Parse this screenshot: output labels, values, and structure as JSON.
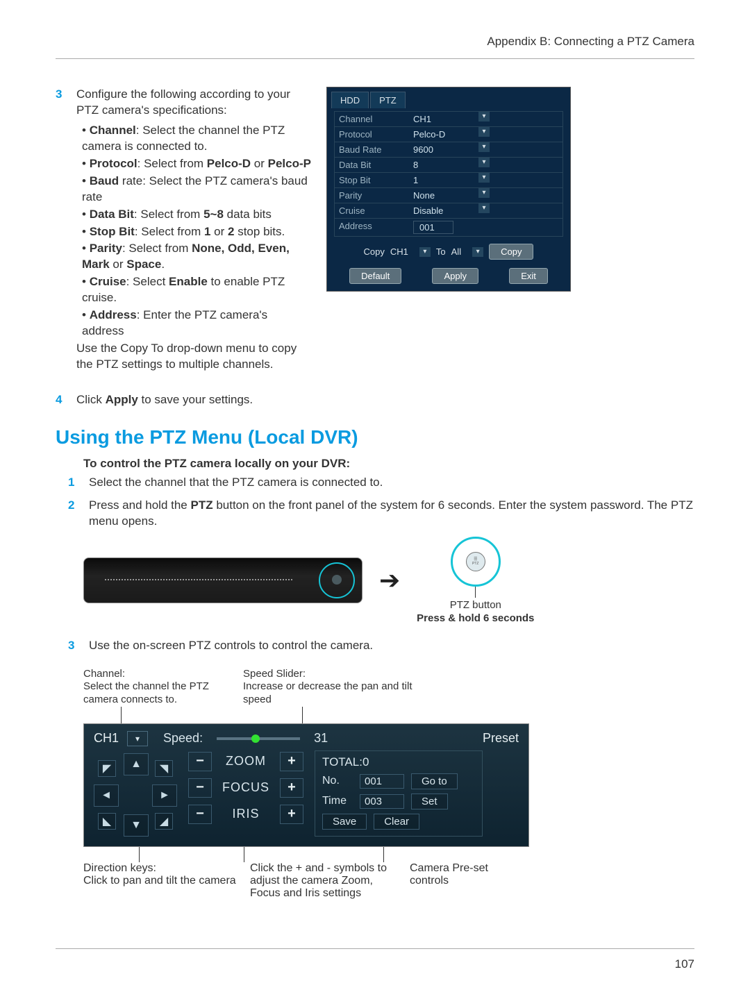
{
  "header": "Appendix B: Connecting a PTZ Camera",
  "page_number": "107",
  "step3_intro": "Configure the following according to your PTZ camera's specifications:",
  "step3_bullets": [
    {
      "bold": "Channel",
      "rest": ": Select the channel the PTZ camera is connected to."
    },
    {
      "bold": "Protocol",
      "rest": ": Select from ",
      "b2": "Pelco-D",
      "r2": " or ",
      "b3": "Pelco-P"
    },
    {
      "bold": "Baud",
      "rest": " rate: Select the PTZ camera's baud rate"
    },
    {
      "bold": "Data Bit",
      "rest": ": Select from ",
      "b2": "5~8",
      "r2": " data bits"
    },
    {
      "bold": "Stop Bit",
      "rest": ": Select from ",
      "b2": "1",
      "r2": " or ",
      "b3": "2",
      "r3": " stop bits."
    },
    {
      "bold": "Parity",
      "rest": ": Select from ",
      "b2": "None, Odd, Even, Mark",
      "r2": " or ",
      "b3": "Space",
      "r3": "."
    },
    {
      "bold": "Cruise",
      "rest": ": Select ",
      "b2": "Enable",
      "r2": " to enable PTZ cruise."
    },
    {
      "bold": "Address",
      "rest": ": Enter the PTZ camera's address"
    }
  ],
  "step3_tail": "Use the Copy To drop-down menu to copy the PTZ settings to multiple channels.",
  "step4_a": "Click ",
  "step4_b": "Apply",
  "step4_c": " to save your settings.",
  "section_title": "Using the PTZ Menu (Local DVR)",
  "sub_heading": "To control the PTZ camera locally on your DVR:",
  "s1": "Select the channel that the PTZ camera is connected to.",
  "s2_a": "Press and hold the ",
  "s2_b": "PTZ",
  "s2_c": " button on the front panel of the system for 6 seconds. Enter the system password. The PTZ menu opens.",
  "ptz_btn_caption": "PTZ button",
  "ptz_hold_caption": "Press & hold 6 seconds",
  "s3": "Use the on-screen PTZ controls to control the camera.",
  "callout_channel": "Channel:\nSelect the channel the PTZ camera connects to.",
  "callout_speed": "Speed Slider:\nIncrease or decrease the pan and tilt speed",
  "callout_dir": "Direction keys:\nClick to pan and tilt the camera",
  "callout_zfi": "Click the + and - symbols to adjust the camera Zoom, Focus and Iris settings",
  "callout_preset": "Camera Pre-set controls",
  "settings": {
    "tabs": [
      "HDD",
      "PTZ"
    ],
    "rows": [
      {
        "label": "Channel",
        "value": "CH1",
        "dd": true
      },
      {
        "label": "Protocol",
        "value": "Pelco-D",
        "dd": true
      },
      {
        "label": "Baud Rate",
        "value": "9600",
        "dd": true
      },
      {
        "label": "Data Bit",
        "value": "8",
        "dd": true
      },
      {
        "label": "Stop Bit",
        "value": "1",
        "dd": true
      },
      {
        "label": "Parity",
        "value": "None",
        "dd": true
      },
      {
        "label": "Cruise",
        "value": "Disable",
        "dd": true
      },
      {
        "label": "Address",
        "value": "001",
        "dd": false
      }
    ],
    "copy_label": "Copy",
    "copy_from": "CH1",
    "copy_to_label": "To",
    "copy_to_value": "All",
    "copy_btn": "Copy",
    "btn_default": "Default",
    "btn_apply": "Apply",
    "btn_exit": "Exit"
  },
  "osd": {
    "ch": "CH1",
    "speed_label": "Speed:",
    "speed_value": "31",
    "preset_title": "Preset",
    "zoom": "ZOOM",
    "focus": "FOCUS",
    "iris": "IRIS",
    "total": "TOTAL:0",
    "no_label": "No.",
    "no_val": "001",
    "goto": "Go to",
    "time_label": "Time",
    "time_val": "003",
    "set": "Set",
    "save": "Save",
    "clear": "Clear"
  }
}
